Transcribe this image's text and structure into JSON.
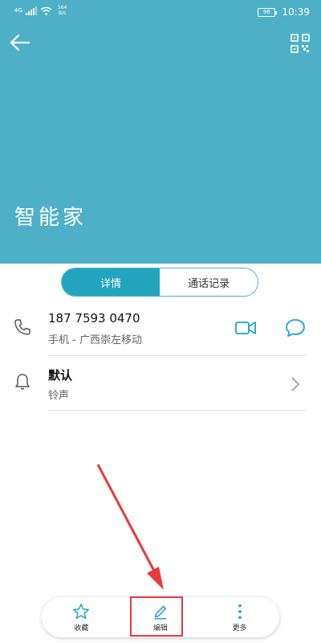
{
  "status_bar": {
    "network": "4G",
    "speed_value": "564",
    "speed_unit": "B/s",
    "battery": "96",
    "time": "10:39"
  },
  "contact": {
    "name": "智能家"
  },
  "tabs": [
    {
      "label": "详情",
      "active": true
    },
    {
      "label": "通话记录",
      "active": false
    }
  ],
  "phone": {
    "number": "187 7593 0470",
    "type_location": "手机 - 广西崇左移动"
  },
  "ringtone": {
    "value": "默认",
    "label": "铃声"
  },
  "bottom_bar": {
    "favorite_label": "收藏",
    "edit_label": "编辑",
    "more_label": "更多"
  },
  "colors": {
    "header": "#4db0c7",
    "accent": "#22a4bf",
    "highlight": "#e83a3a"
  }
}
